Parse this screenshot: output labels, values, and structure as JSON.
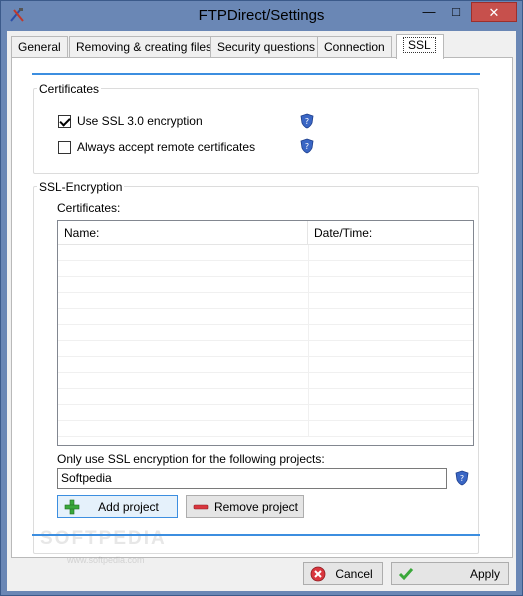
{
  "window": {
    "title": "FTPDirect/Settings",
    "minimize_glyph": "—",
    "maximize_glyph": "□",
    "close_glyph": "✕"
  },
  "tabs": [
    {
      "label": "General"
    },
    {
      "label": "Removing & creating files"
    },
    {
      "label": "Security questions"
    },
    {
      "label": "Connection"
    },
    {
      "label": "SSL"
    }
  ],
  "certificates_group": {
    "label": "Certificates",
    "use_ssl": {
      "label": "Use SSL 3.0 encryption",
      "checked": true
    },
    "always_accept": {
      "label": "Always accept remote certificates",
      "checked": false
    }
  },
  "ssl_group": {
    "label": "SSL-Encryption",
    "certificates_label": "Certificates:",
    "columns": [
      "Name:",
      "Date/Time:"
    ],
    "only_use_label": "Only use SSL encryption for the following projects:",
    "project_value": "Softpedia",
    "add_project": "Add project",
    "remove_project": "Remove project"
  },
  "footer": {
    "cancel": "Cancel",
    "apply": "Apply"
  },
  "watermark": {
    "big": "SOFTPEDIA",
    "small": "www.softpedia.com"
  },
  "colors": {
    "accent_rule": "#3c8ee0",
    "title_bar": "#6a87b5",
    "close_button": "#c7504c"
  }
}
